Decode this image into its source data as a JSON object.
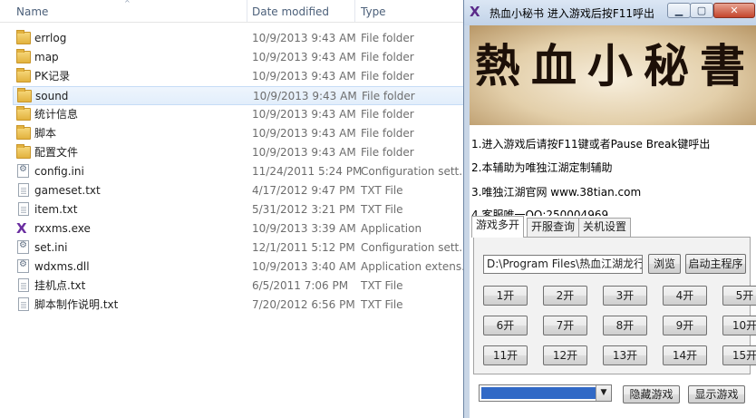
{
  "explorer": {
    "columns": {
      "name": "Name",
      "date": "Date modified",
      "type": "Type"
    },
    "selected_index": 3,
    "rows": [
      {
        "name": "errlog",
        "date": "10/9/2013 9:43 AM",
        "type": "File folder",
        "icon": "folder-icon"
      },
      {
        "name": "map",
        "date": "10/9/2013 9:43 AM",
        "type": "File folder",
        "icon": "folder-icon"
      },
      {
        "name": "PK记录",
        "date": "10/9/2013 9:43 AM",
        "type": "File folder",
        "icon": "folder-icon"
      },
      {
        "name": "sound",
        "date": "10/9/2013 9:43 AM",
        "type": "File folder",
        "icon": "folder-icon"
      },
      {
        "name": "统计信息",
        "date": "10/9/2013 9:43 AM",
        "type": "File folder",
        "icon": "folder-icon"
      },
      {
        "name": "脚本",
        "date": "10/9/2013 9:43 AM",
        "type": "File folder",
        "icon": "folder-icon"
      },
      {
        "name": "配置文件",
        "date": "10/9/2013 9:43 AM",
        "type": "File folder",
        "icon": "folder-icon"
      },
      {
        "name": "config.ini",
        "date": "11/24/2011 5:24 PM",
        "type": "Configuration sett...",
        "icon": "settings-file-icon"
      },
      {
        "name": "gameset.txt",
        "date": "4/17/2012 9:47 PM",
        "type": "TXT File",
        "icon": "text-file-icon"
      },
      {
        "name": "item.txt",
        "date": "5/31/2012 3:21 PM",
        "type": "TXT File",
        "icon": "text-file-icon"
      },
      {
        "name": "rxxms.exe",
        "date": "10/9/2013 3:39 AM",
        "type": "Application",
        "icon": "application-icon"
      },
      {
        "name": "set.ini",
        "date": "12/1/2011 5:12 PM",
        "type": "Configuration sett...",
        "icon": "settings-file-icon"
      },
      {
        "name": "wdxms.dll",
        "date": "10/9/2013 3:40 AM",
        "type": "Application extens...",
        "icon": "settings-file-icon"
      },
      {
        "name": "挂机点.txt",
        "date": "6/5/2011 7:06 PM",
        "type": "TXT File",
        "icon": "text-file-icon"
      },
      {
        "name": "脚本制作说明.txt",
        "date": "7/20/2012 6:56 PM",
        "type": "TXT File",
        "icon": "text-file-icon"
      }
    ]
  },
  "window": {
    "title": "热血小秘书  进入游戏后按F11呼出",
    "icon": "app-x-icon",
    "banner_text": "熱血小秘書",
    "info": [
      "1.进入游戏后请按F11键或者Pause Break键呼出",
      "2.本辅助为唯独江湖定制辅助",
      "3.唯独江湖官网 www.38tian.com",
      "4.客服唯一QQ:250004969"
    ],
    "tabs": [
      "游戏多开",
      "开服查询",
      "关机设置"
    ],
    "active_tab": 0,
    "path_value": "D:\\Program Files\\热血江湖龙行绝刃",
    "browse_label": "浏览",
    "launch_label": "启动主程序",
    "open_buttons": [
      "1开",
      "2开",
      "3开",
      "4开",
      "5开",
      "6开",
      "7开",
      "8开",
      "9开",
      "10开",
      "11开",
      "12开",
      "13开",
      "14开",
      "15开"
    ],
    "hide_label": "隐藏游戏",
    "show_label": "显示游戏",
    "colors": {
      "selection": "#3169c6",
      "close": "#c4452c"
    }
  }
}
